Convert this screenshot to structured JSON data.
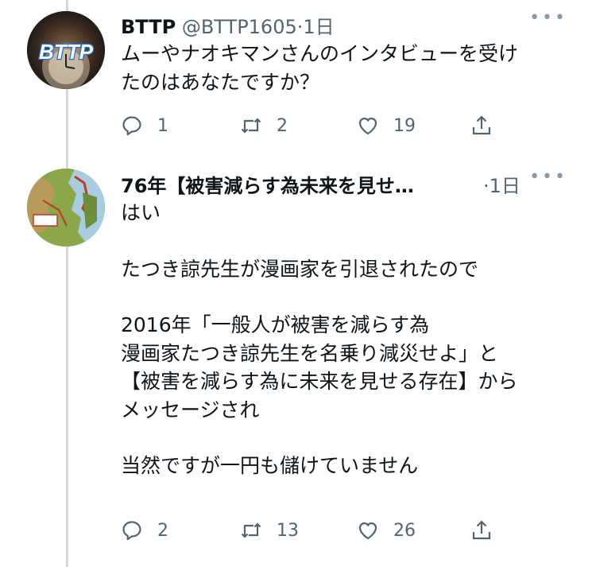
{
  "tweets": [
    {
      "author": "BTTP",
      "handle": "@BTTP1605",
      "time": "1日",
      "avatar_text": "BTTP",
      "text": [
        "ムーやナオキマンさんのインタビューを受け",
        "たのはあなたですか？"
      ],
      "replies": "1",
      "retweets": "2",
      "likes": "19"
    },
    {
      "author": "76年【被害減らす為未来を見せ…",
      "time": "1日",
      "text": [
        "はい",
        "",
        "たつき諒先生が漫画家を引退されたので",
        "",
        "2016年「一般人が被害を減らす為",
        "漫画家たつき諒先生を名乗り減災せよ」と",
        "【被害を減らす為に未来を見せる存在】から",
        "メッセージされ",
        "",
        "当然ですが一円も儲けていません"
      ],
      "replies": "2",
      "retweets": "13",
      "likes": "26"
    }
  ],
  "icons": [
    "reply-icon",
    "retweet-icon",
    "like-icon",
    "share-icon",
    "more-icon"
  ],
  "colors": {
    "secondary": "#536471",
    "thread_line": "#cfd9de",
    "brand_blue": "#1d6fd8"
  }
}
